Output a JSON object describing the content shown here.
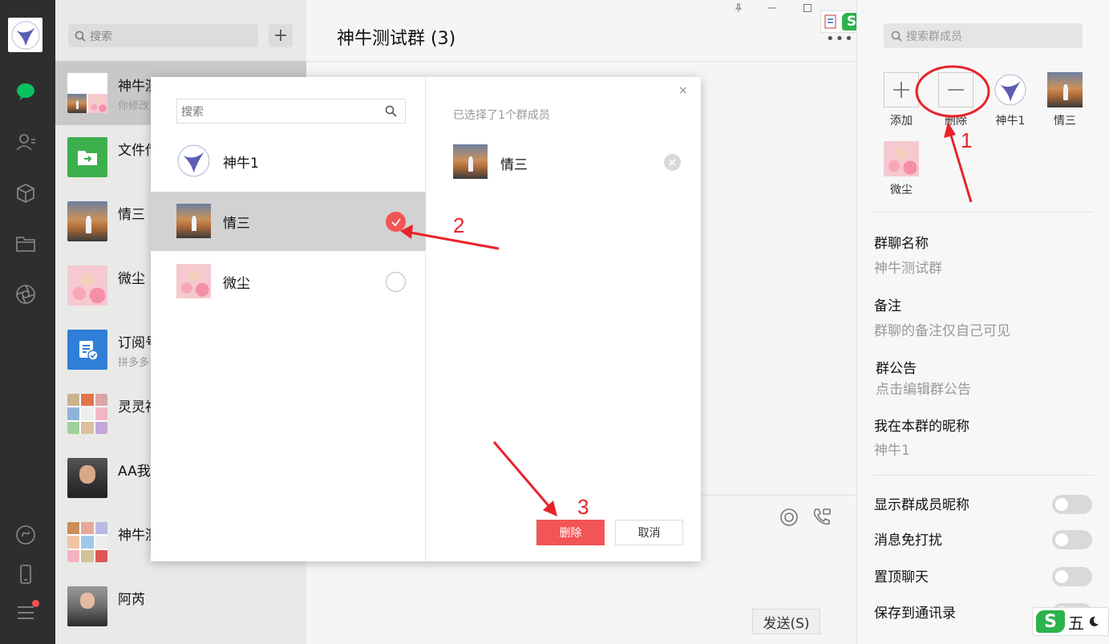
{
  "chatlist": {
    "search_placeholder": "搜索",
    "add_label": "+",
    "items": [
      {
        "name": "神牛测试群",
        "sub": "你修改了群聊名称"
      },
      {
        "name": "文件传输助手",
        "sub": ""
      },
      {
        "name": "情三",
        "sub": ""
      },
      {
        "name": "微尘",
        "sub": ""
      },
      {
        "name": "订阅号",
        "sub": "拼多多"
      },
      {
        "name": "灵灵福利群",
        "sub": ""
      },
      {
        "name": "AA我",
        "sub": ""
      },
      {
        "name": "神牛测试群",
        "sub": ""
      },
      {
        "name": "阿芮",
        "sub": ""
      }
    ]
  },
  "main": {
    "title": "神牛测试群 (3)",
    "send_label": "发送(S)"
  },
  "panel": {
    "search_placeholder": "搜索群成员",
    "members": [
      {
        "name": "添加",
        "icon": "plus-icon"
      },
      {
        "name": "删除",
        "icon": "minus-icon"
      },
      {
        "name": "神牛1",
        "icon": "bird-avatar"
      },
      {
        "name": "情三",
        "icon": "photo-avatar"
      },
      {
        "name": "微尘",
        "icon": "pink-avatar"
      }
    ],
    "group_name_label": "群聊名称",
    "group_name_value": "神牛测试群",
    "remark_label": "备注",
    "remark_value": "群聊的备注仅自己可见",
    "notice_label": "群公告",
    "notice_value": "点击编辑群公告",
    "nickname_label": "我在本群的昵称",
    "nickname_value": "神牛1",
    "toggles": [
      {
        "label": "显示群成员昵称",
        "on": false
      },
      {
        "label": "消息免打扰",
        "on": false
      },
      {
        "label": "置顶聊天",
        "on": false
      },
      {
        "label": "保存到通讯录",
        "on": false
      }
    ]
  },
  "modal": {
    "search_placeholder": "搜索",
    "close_label": "×",
    "members": [
      {
        "name": "神牛1",
        "selected": false,
        "checkable": false
      },
      {
        "name": "情三",
        "selected": true,
        "checkable": true
      },
      {
        "name": "微尘",
        "selected": false,
        "checkable": true
      }
    ],
    "selected_title": "已选择了1个群成员",
    "selected_members": [
      {
        "name": "情三"
      }
    ],
    "delete_label": "删除",
    "cancel_label": "取消"
  },
  "annotations": {
    "n1": "1",
    "n2": "2",
    "n3": "3"
  },
  "ime": {
    "mode": "五"
  },
  "colors": {
    "accent_red": "#f25555",
    "wechat_green": "#07c160",
    "annotation_red": "#e8232a"
  }
}
